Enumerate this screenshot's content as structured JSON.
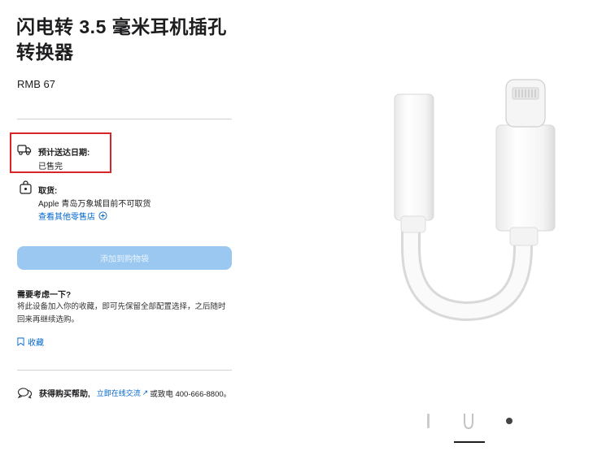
{
  "product": {
    "title": "闪电转 3.5 毫米耳机插孔转换器",
    "price": "RMB 67"
  },
  "delivery": {
    "label": "预计送达日期:",
    "status": "已售完",
    "icon": "truck-icon"
  },
  "pickup": {
    "label": "取货:",
    "status": "Apple 青岛万象城目前不可取货",
    "link": "查看其他零售店",
    "icon": "bag-icon"
  },
  "actions": {
    "add_to_bag": "添加到购物袋"
  },
  "consider": {
    "title": "需要考虑一下?",
    "text": "将此设备加入你的收藏，即可先保留全部配置选择，之后随时回来再继续选购。",
    "save_label": "收藏"
  },
  "help": {
    "label": "获得购买帮助,",
    "chat_link": "立即在线交流",
    "call_text": "或致电 400-666-8800。"
  },
  "colors": {
    "link": "#0066cc",
    "button_disabled": "#9ac8f0",
    "highlight_border": "#d6262a"
  }
}
